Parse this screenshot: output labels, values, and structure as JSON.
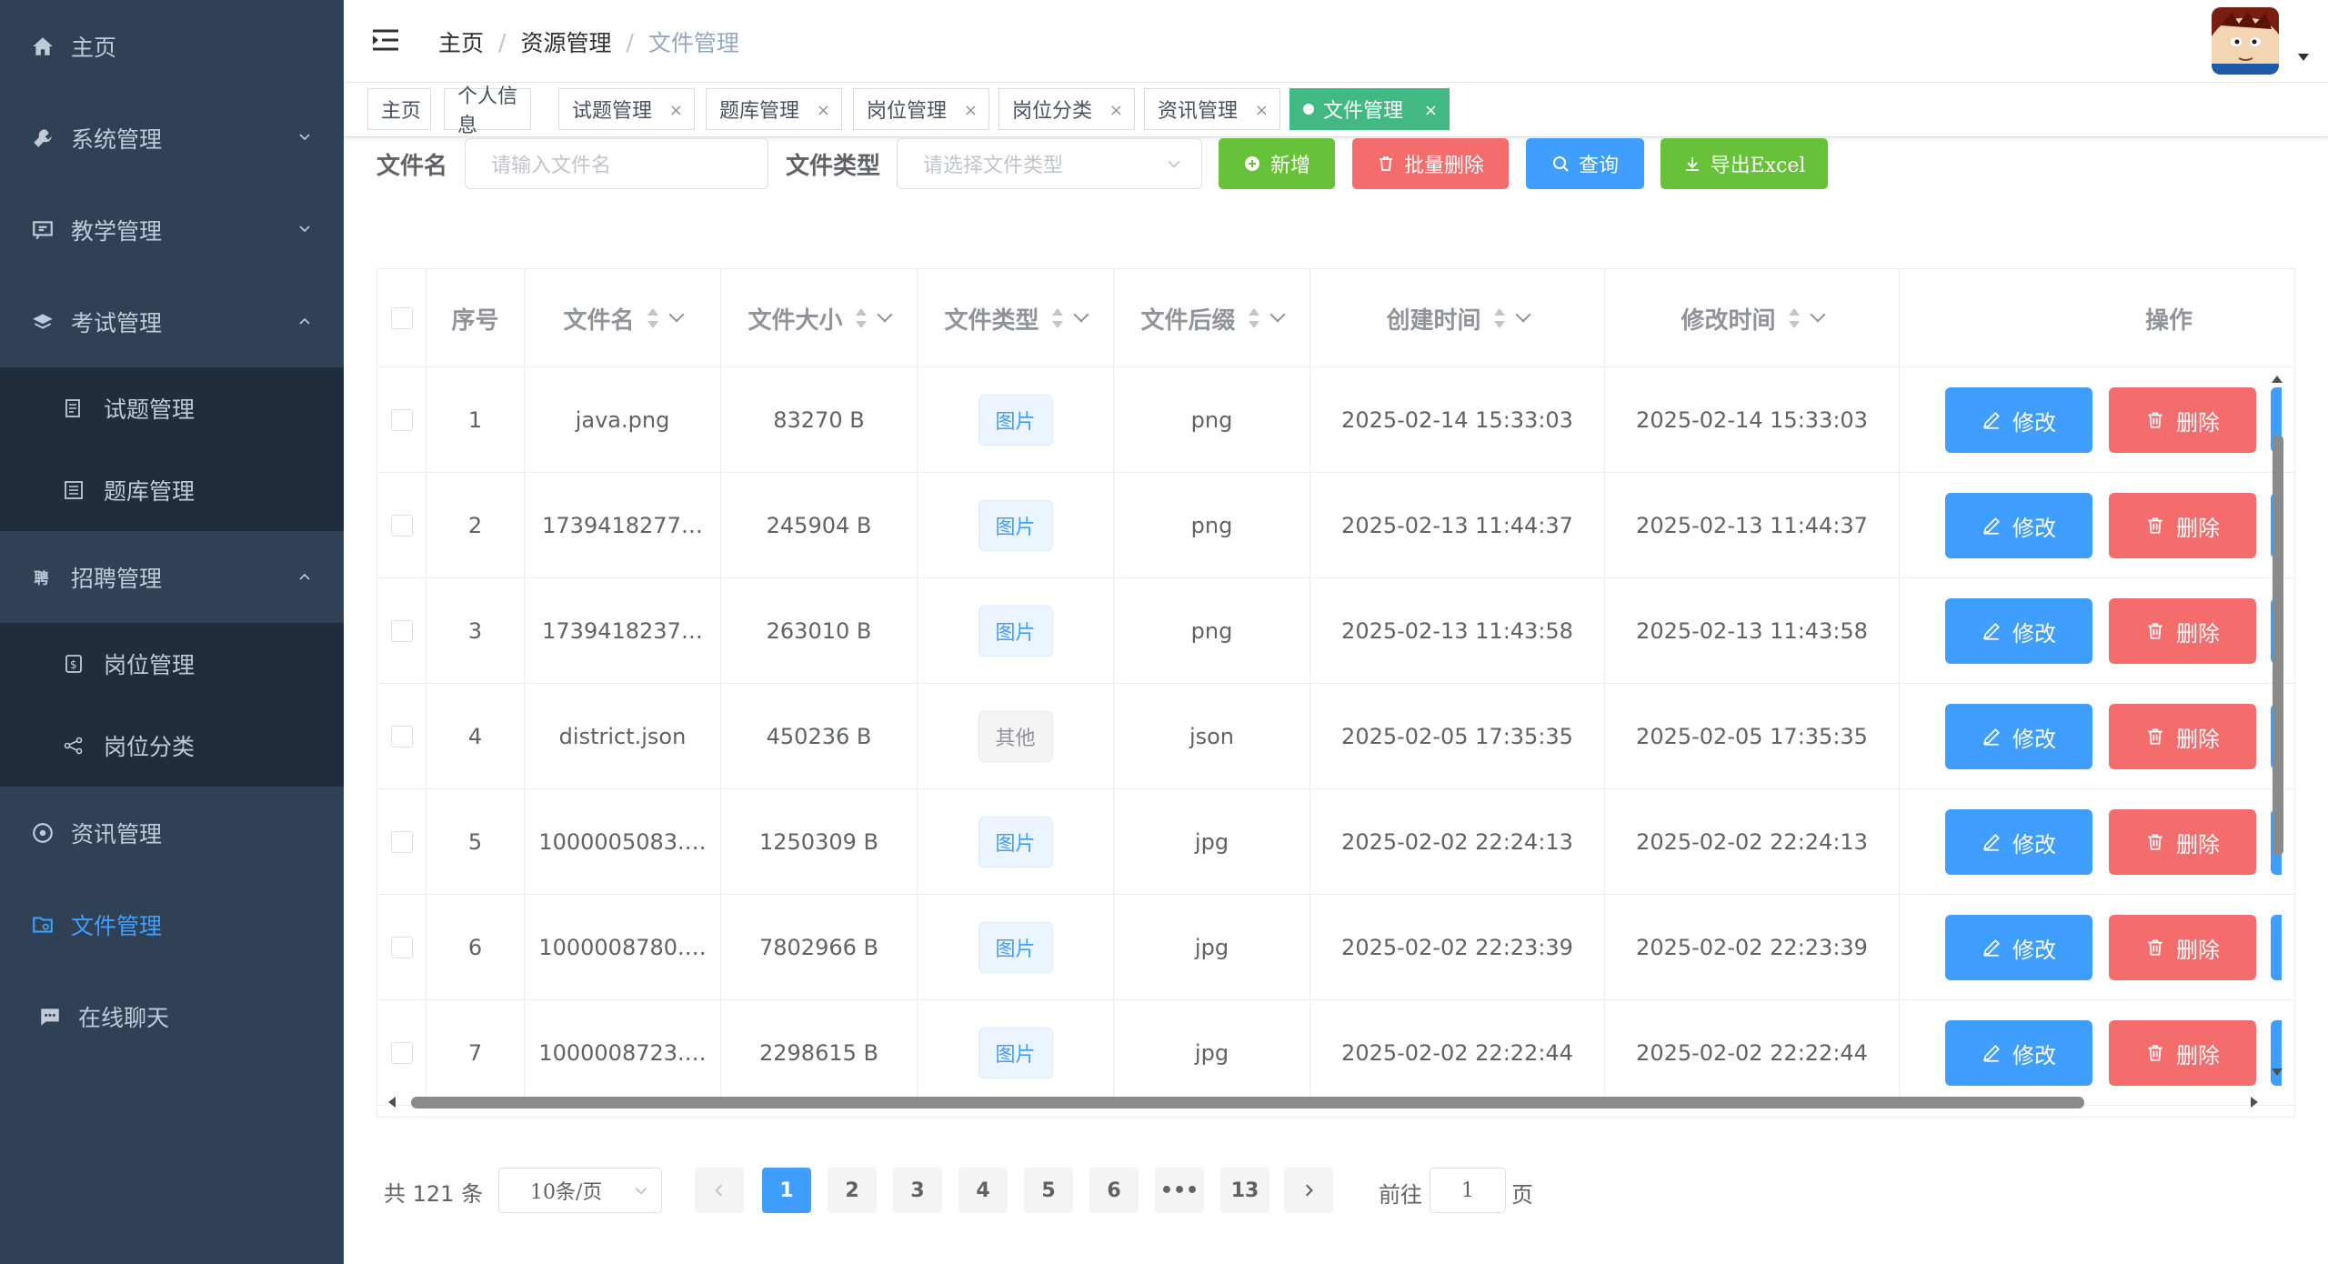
{
  "sidebar": {
    "items": [
      {
        "label": "主页",
        "icon": "home-icon"
      },
      {
        "label": "系统管理",
        "icon": "wrench-icon"
      },
      {
        "label": "教学管理",
        "icon": "chat-board-icon"
      },
      {
        "label": "考试管理",
        "icon": "layers-icon"
      },
      {
        "label": "试题管理",
        "icon": "doc-icon"
      },
      {
        "label": "题库管理",
        "icon": "list-doc-icon"
      },
      {
        "label": "招聘管理",
        "icon": "recruit-icon"
      },
      {
        "label": "岗位管理",
        "icon": "job-icon"
      },
      {
        "label": "岗位分类",
        "icon": "category-icon"
      },
      {
        "label": "资讯管理",
        "icon": "news-icon"
      },
      {
        "label": "文件管理",
        "icon": "folder-icon"
      },
      {
        "label": "在线聊天",
        "icon": "chat-icon"
      }
    ],
    "active_color": "#409eff"
  },
  "header": {
    "breadcrumb": [
      "主页",
      "资源管理",
      "文件管理"
    ]
  },
  "tags": [
    {
      "label": "主页"
    },
    {
      "label": "个人信息"
    },
    {
      "label": "试题管理"
    },
    {
      "label": "题库管理"
    },
    {
      "label": "岗位管理"
    },
    {
      "label": "岗位分类"
    },
    {
      "label": "资讯管理"
    },
    {
      "label": "文件管理"
    }
  ],
  "search": {
    "name_label": "文件名",
    "name_placeholder": "请输入文件名",
    "type_label": "文件类型",
    "type_placeholder": "请选择文件类型",
    "add_label": "新增",
    "batch_delete_label": "批量删除",
    "query_label": "查询",
    "export_label": "导出Excel"
  },
  "table": {
    "headers": [
      "序号",
      "文件名",
      "文件大小",
      "文件类型",
      "文件后缀",
      "创建时间",
      "修改时间",
      "操作"
    ],
    "edit_label": "修改",
    "delete_label": "删除",
    "rows": [
      {
        "no": "1",
        "name": "java.png",
        "size": "83270 B",
        "type": "图片",
        "suffix": "png",
        "created": "2025-02-14 15:33:03",
        "modified": "2025-02-14 15:33:03"
      },
      {
        "no": "2",
        "name": "1739418277…",
        "size": "245904 B",
        "type": "图片",
        "suffix": "png",
        "created": "2025-02-13 11:44:37",
        "modified": "2025-02-13 11:44:37"
      },
      {
        "no": "3",
        "name": "1739418237…",
        "size": "263010 B",
        "type": "图片",
        "suffix": "png",
        "created": "2025-02-13 11:43:58",
        "modified": "2025-02-13 11:43:58"
      },
      {
        "no": "4",
        "name": "district.json",
        "size": "450236 B",
        "type": "其他",
        "suffix": "json",
        "created": "2025-02-05 17:35:35",
        "modified": "2025-02-05 17:35:35"
      },
      {
        "no": "5",
        "name": "1000005083.…",
        "size": "1250309 B",
        "type": "图片",
        "suffix": "jpg",
        "created": "2025-02-02 22:24:13",
        "modified": "2025-02-02 22:24:13"
      },
      {
        "no": "6",
        "name": "1000008780.…",
        "size": "7802966 B",
        "type": "图片",
        "suffix": "jpg",
        "created": "2025-02-02 22:23:39",
        "modified": "2025-02-02 22:23:39"
      },
      {
        "no": "7",
        "name": "1000008723.…",
        "size": "2298615 B",
        "type": "图片",
        "suffix": "jpg",
        "created": "2025-02-02 22:22:44",
        "modified": "2025-02-02 22:22:44"
      }
    ]
  },
  "pagination": {
    "total": "共 121 条",
    "page_size": "10条/页",
    "pages": [
      "1",
      "2",
      "3",
      "4",
      "5",
      "6",
      "•••",
      "13"
    ],
    "current": "1",
    "goto_label": "前往",
    "goto_value": "1",
    "page_suffix": "页"
  }
}
